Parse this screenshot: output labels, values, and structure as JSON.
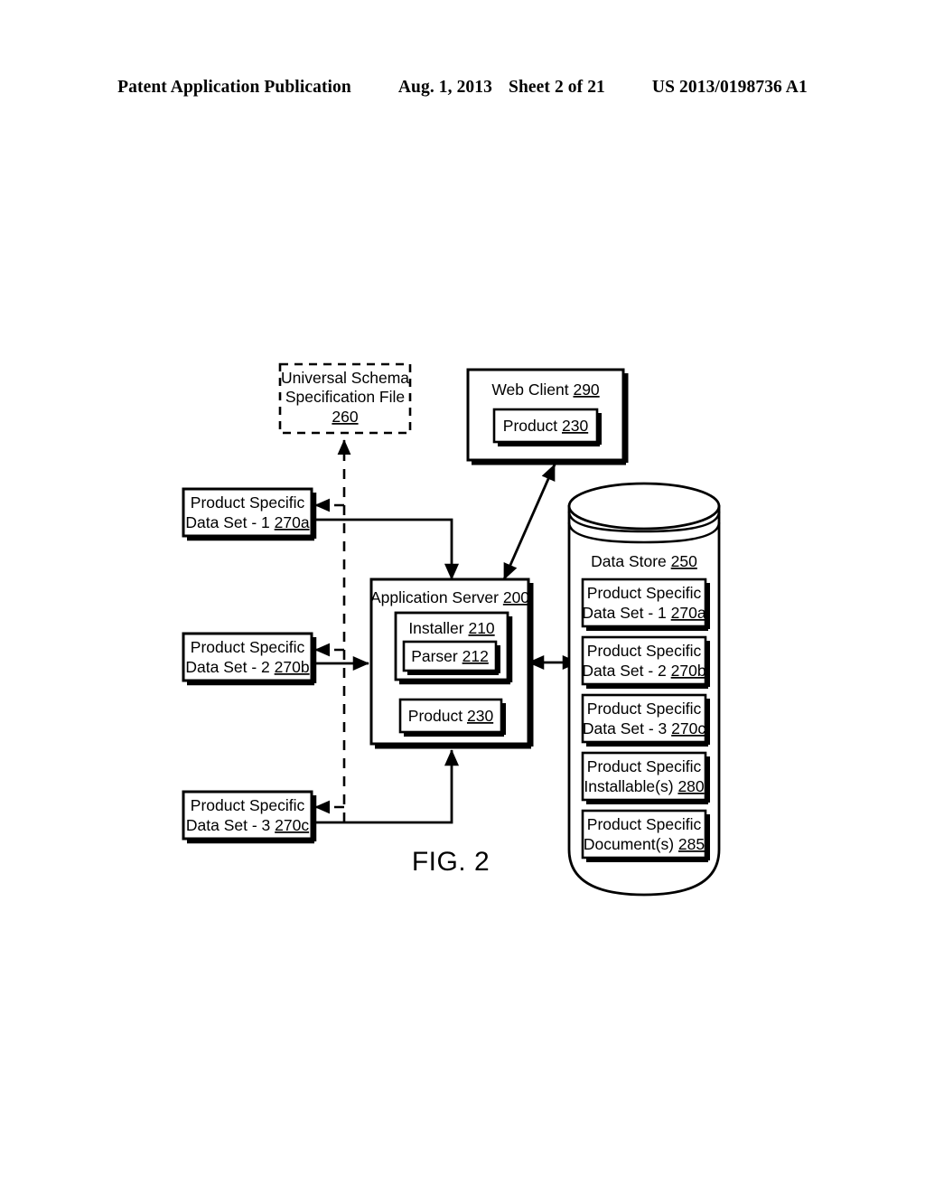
{
  "header": {
    "publication": "Patent Application Publication",
    "date": "Aug. 1, 2013",
    "sheet": "Sheet 2 of 21",
    "patent_number": "US 2013/0198736 A1"
  },
  "figure": {
    "label": "FIG. 2",
    "schema_file": {
      "line1": "Universal Schema",
      "line2": "Specification File",
      "ref": "260"
    },
    "web_client": {
      "title": "Web Client",
      "ref": "290",
      "product": {
        "title": "Product",
        "ref": "230"
      }
    },
    "application_server": {
      "title": "Application Server",
      "ref": "200",
      "installer": {
        "title": "Installer",
        "ref": "210",
        "parser": {
          "title": "Parser",
          "ref": "212"
        }
      },
      "product": {
        "title": "Product",
        "ref": "230"
      }
    },
    "data_store": {
      "title": "Data Store",
      "ref": "250",
      "items": [
        {
          "line1": "Product Specific",
          "line2": "Data Set - 1",
          "ref": "270a"
        },
        {
          "line1": "Product Specific",
          "line2": "Data Set - 2",
          "ref": "270b"
        },
        {
          "line1": "Product Specific",
          "line2": "Data Set - 3",
          "ref": "270c"
        },
        {
          "line1": "Product Specific",
          "line2": "Installable(s)",
          "ref": "280"
        },
        {
          "line1": "Product Specific",
          "line2": "Document(s)",
          "ref": "285"
        }
      ]
    },
    "data_sets": [
      {
        "line1": "Product Specific",
        "line2": "Data Set - 1",
        "ref": "270a"
      },
      {
        "line1": "Product Specific",
        "line2": "Data Set - 2",
        "ref": "270b"
      },
      {
        "line1": "Product Specific",
        "line2": "Data Set - 3",
        "ref": "270c"
      }
    ]
  },
  "style": {
    "ink": "#000000",
    "paper": "#ffffff"
  }
}
